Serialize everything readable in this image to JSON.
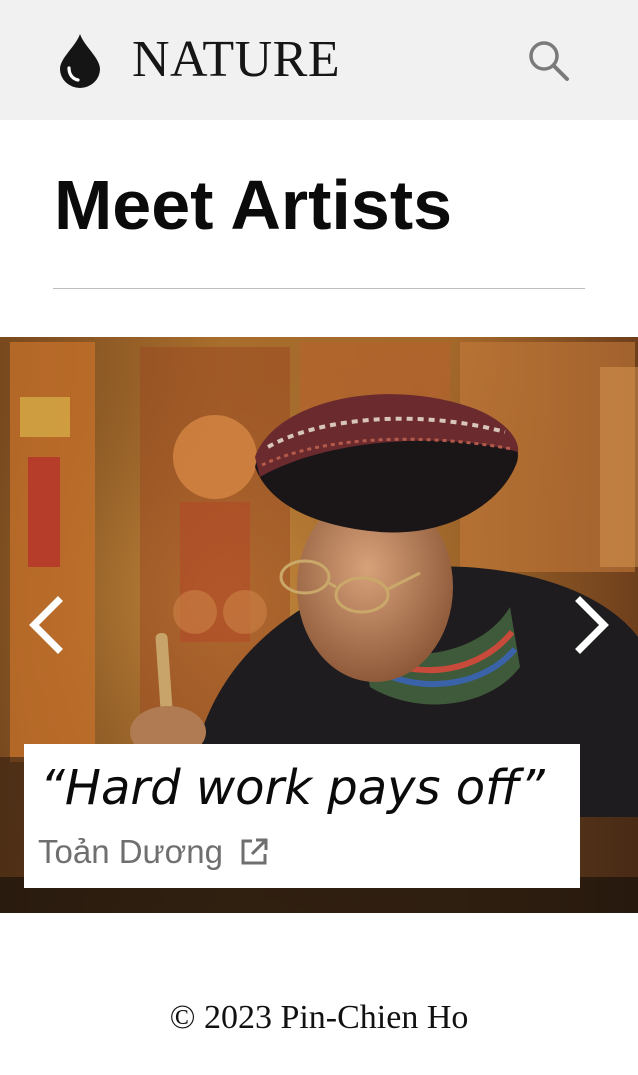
{
  "header": {
    "logo_icon": "water-drop-icon",
    "brand": "NATURE",
    "search_icon": "search-icon"
  },
  "main": {
    "title": "Meet Artists"
  },
  "carousel": {
    "prev_icon": "chevron-left-icon",
    "next_icon": "chevron-right-icon",
    "slide": {
      "quote": "“Hard work pays off”",
      "artist": "Toản Dương",
      "link_icon": "external-link-icon"
    }
  },
  "footer": {
    "copyright": "© 2023 Pin-Chien Ho"
  },
  "colors": {
    "header_bg": "#f1f1f1",
    "text": "#111111",
    "muted_text": "#6f6f6f",
    "divider": "#bdbdbd"
  }
}
